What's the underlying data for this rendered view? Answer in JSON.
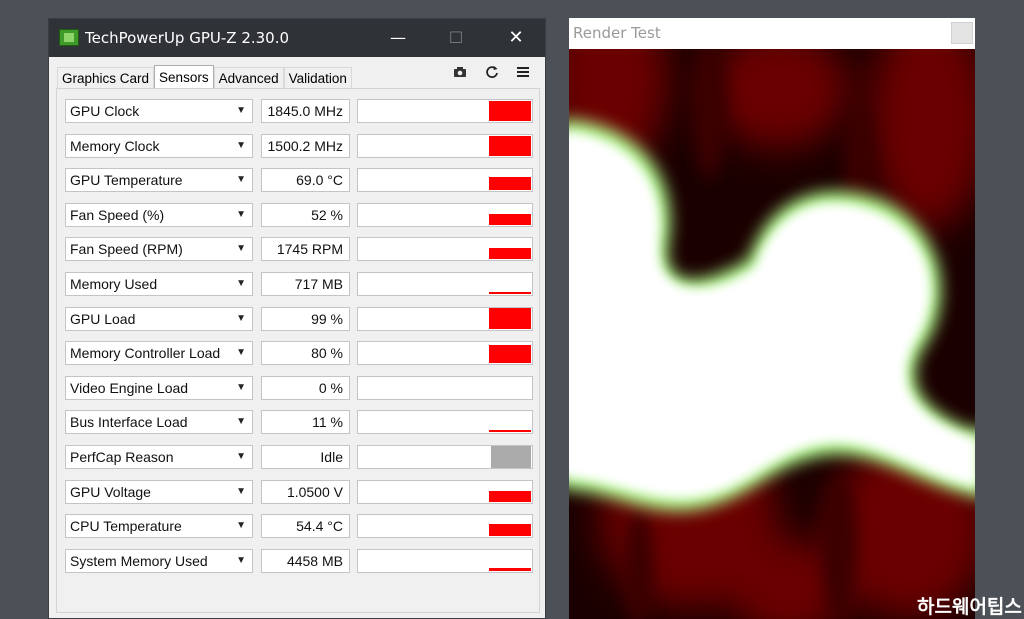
{
  "window": {
    "title": "TechPowerUp GPU-Z 2.30.0",
    "minimize_glyph": "—",
    "maximize_glyph": "☐",
    "close_glyph": "✕"
  },
  "tabs": [
    {
      "label": "Graphics Card",
      "active": false
    },
    {
      "label": "Sensors",
      "active": true
    },
    {
      "label": "Advanced",
      "active": false
    },
    {
      "label": "Validation",
      "active": false
    }
  ],
  "toolbar": {
    "camera_icon": "camera-icon",
    "refresh_icon": "refresh-icon",
    "menu_icon": "hamburger-menu-icon"
  },
  "sensors": [
    {
      "label": "GPU Clock",
      "value": "1845.0 MHz",
      "level": 0.92
    },
    {
      "label": "Memory Clock",
      "value": "1500.2 MHz",
      "level": 0.9
    },
    {
      "label": "GPU Temperature",
      "value": "69.0 °C",
      "level": 0.6
    },
    {
      "label": "Fan Speed (%)",
      "value": "52 %",
      "level": 0.52
    },
    {
      "label": "Fan Speed (RPM)",
      "value": "1745 RPM",
      "level": 0.5
    },
    {
      "label": "Memory Used",
      "value": "717 MB",
      "level": 0.09
    },
    {
      "label": "GPU Load",
      "value": "99 %",
      "level": 0.99
    },
    {
      "label": "Memory Controller Load",
      "value": "80 %",
      "level": 0.8
    },
    {
      "label": "Video Engine Load",
      "value": "0 %",
      "level": 0
    },
    {
      "label": "Bus Interface Load",
      "value": "11 %",
      "level": 0.11
    },
    {
      "label": "PerfCap Reason",
      "value": "Idle",
      "level": 1,
      "gray": true
    },
    {
      "label": "GPU Voltage",
      "value": "1.0500 V",
      "level": 0.5
    },
    {
      "label": "CPU Temperature",
      "value": "54.4 °C",
      "level": 0.54
    },
    {
      "label": "System Memory Used",
      "value": "4458 MB",
      "level": 0.15
    }
  ],
  "render_test": {
    "title": "Render Test"
  },
  "colors": {
    "graph_fill": "#ff0000",
    "graph_idle": "#ababab",
    "titlebar": "#2f3337"
  },
  "watermark": "하드웨어팁스"
}
